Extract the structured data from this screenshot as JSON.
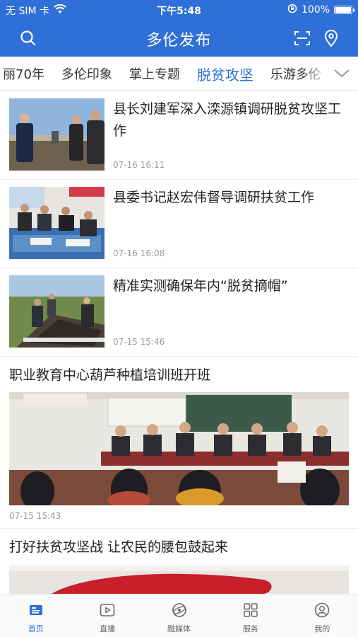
{
  "status_bar": {
    "carrier": "无 SIM 卡",
    "time": "下午5:48",
    "battery": "100%",
    "icons": [
      "wifi-icon",
      "orientation-lock-icon",
      "battery-icon"
    ]
  },
  "header": {
    "title": "多伦发布",
    "icons": [
      "search-icon",
      "scan-icon",
      "location-icon"
    ]
  },
  "tabs": {
    "items": [
      "丽70年",
      "多伦印象",
      "掌上专题",
      "脱贫攻坚",
      "乐游多伦"
    ],
    "active": "脱贫攻坚",
    "more_icon": "chevron-down-icon"
  },
  "feed": {
    "items": [
      {
        "title": "县长刘建军深入滦源镇调研脱贫攻坚工作",
        "time": "07-16 16:11"
      },
      {
        "title": "县委书记赵宏伟督导调研扶贫工作",
        "time": "07-16 16:08"
      },
      {
        "title": "精准实测确保年内“脱贫摘帽”",
        "time": "07-15 15:46"
      },
      {
        "title": "职业教育中心葫芦种植培训班开班",
        "time": "07-15 15:43"
      },
      {
        "title": "打好扶贫攻坚战 让农民的腰包鼓起来"
      }
    ]
  },
  "tabbar": {
    "items": [
      {
        "label": "首页",
        "icon": "home-icon"
      },
      {
        "label": "直播",
        "icon": "live-play-icon"
      },
      {
        "label": "融媒体",
        "icon": "media-globe-icon"
      },
      {
        "label": "服务",
        "icon": "services-grid-icon"
      },
      {
        "label": "我的",
        "icon": "profile-icon"
      }
    ],
    "active": "首页"
  },
  "colors": {
    "brand_blue": "#2f6fd8",
    "text": "#222222",
    "muted": "#999999"
  }
}
